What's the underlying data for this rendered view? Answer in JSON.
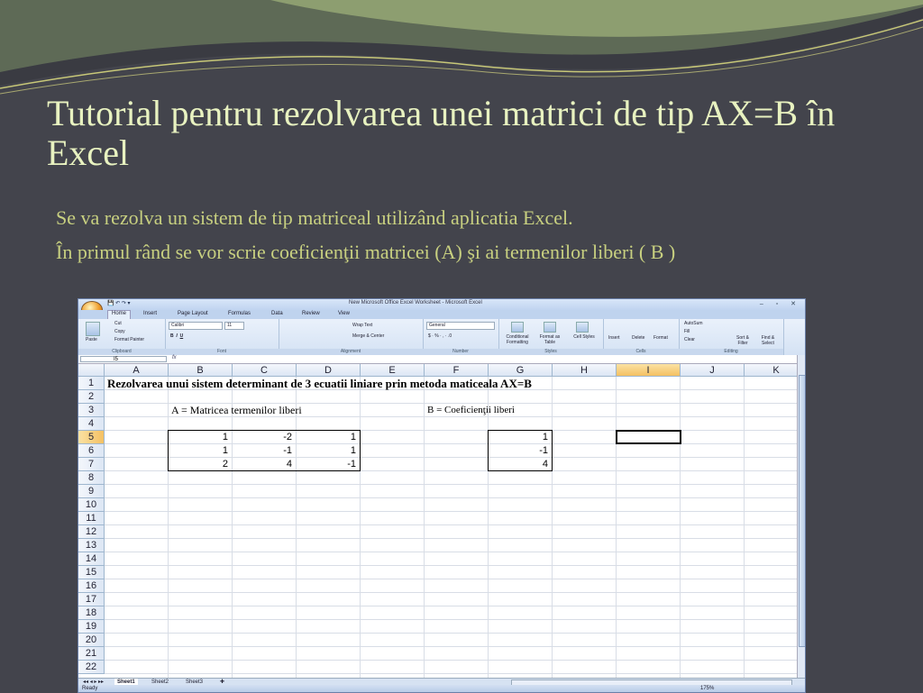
{
  "slide": {
    "title": "Tutorial pentru rezolvarea unei matrici de tip AX=B în Excel",
    "bullets": [
      "Se va rezolva un sistem de tip matriceal utilizând aplicatia Excel.",
      "În primul rând se vor scrie coeficienţii matricei (A) şi ai termenilor liberi ( B )"
    ]
  },
  "excel": {
    "window_title": "New Microsoft Office Excel Worksheet - Microsoft Excel",
    "tabs": [
      "Home",
      "Insert",
      "Page Layout",
      "Formulas",
      "Data",
      "Review",
      "View"
    ],
    "ribbon": {
      "clipboard": {
        "label": "Clipboard",
        "paste": "Paste",
        "cut": "Cut",
        "copy": "Copy",
        "format_painter": "Format Painter"
      },
      "font": {
        "label": "Font",
        "name": "Calibri",
        "size": "11"
      },
      "alignment": {
        "label": "Alignment",
        "wrap": "Wrap Text",
        "merge": "Merge & Center"
      },
      "number": {
        "label": "Number",
        "format": "General"
      },
      "styles": {
        "label": "Styles",
        "cond": "Conditional Formatting",
        "table": "Format as Table",
        "cell": "Cell Styles"
      },
      "cells": {
        "label": "Cells",
        "insert": "Insert",
        "delete": "Delete",
        "format": "Format"
      },
      "editing": {
        "label": "Editing",
        "autosum": "AutoSum",
        "fill": "Fill",
        "clear": "Clear",
        "sort": "Sort & Filter",
        "find": "Find & Select"
      }
    },
    "name_box": "I5",
    "fx": "fx",
    "columns": [
      "A",
      "B",
      "C",
      "D",
      "E",
      "F",
      "G",
      "H",
      "I",
      "J",
      "K"
    ],
    "rows": [
      "1",
      "2",
      "3",
      "4",
      "5",
      "6",
      "7",
      "8",
      "9",
      "10",
      "11",
      "12",
      "13",
      "14",
      "15",
      "16",
      "17",
      "18",
      "19",
      "20",
      "21",
      "22"
    ],
    "selected_column": "I",
    "selected_row": "5",
    "cells": {
      "heading": "Rezolvarea unui sistem determinant de 3 ecuatii liniare prin metoda maticeala AX=B",
      "label_a": "A = Matricea termenilor liberi",
      "label_b": "B = Coeficienţii liberi",
      "matrix_a": [
        [
          "1",
          "-2",
          "1"
        ],
        [
          "1",
          "-1",
          "1"
        ],
        [
          "2",
          "4",
          "-1"
        ]
      ],
      "vector_b": [
        "1",
        "-1",
        "4"
      ]
    },
    "sheets": [
      "Sheet1",
      "Sheet2",
      "Sheet3"
    ],
    "status": "Ready",
    "zoom": "175%"
  },
  "colors": {
    "background": "#43444c",
    "title": "#e8f2c0",
    "bullet": "#c8d080"
  }
}
